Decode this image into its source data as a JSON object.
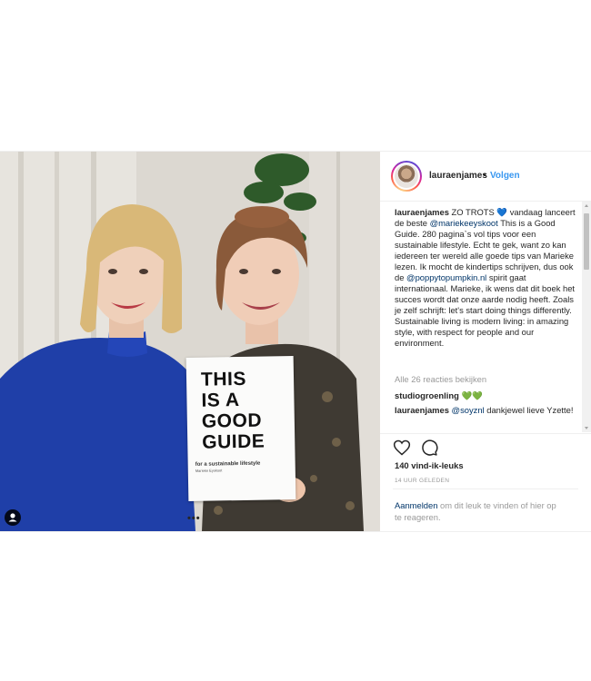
{
  "post": {
    "username": "lauraenjames",
    "dot": "•",
    "follow_label": "Volgen",
    "caption": {
      "username": "lauraenjames",
      "part1": "ZO TROTS",
      "heart": "💙",
      "part2": "vandaag lanceert de beste",
      "mention1": "@mariekeeyskoot",
      "part3": "This is a Good Guide. 280 pagina`s vol tips voor een sustainable lifestyle. Echt te gek, want zo kan iedereen ter wereld alle goede tips van Marieke lezen. Ik mocht de kindertips schrijven, dus ook de",
      "mention2": "@poppytopumpkin.nl",
      "part4": "spirit gaat internationaal. Marieke, ik wens dat dit boek het succes wordt dat onze aarde nodig heeft. Zoals je zelf schrijft: let's start doing things differently. Sustainable living is modern living: in amazing style, with respect for people and our environment."
    },
    "view_all_comments": "Alle 26 reacties bekijken",
    "comments": [
      {
        "username": "studiogroenling",
        "text": "",
        "hearts": "💚💚"
      },
      {
        "username": "lauraenjames",
        "mention": "@soyznl",
        "text": "dankjewel lieve Yzette!"
      }
    ],
    "likes": "140 vind-ik-leuks",
    "time": "14 UUR GELEDEN",
    "login": {
      "link": "Aanmelden",
      "text": "om dit leuk te vinden of hier op te reageren."
    },
    "more": "•••"
  },
  "book": {
    "line1": "THIS",
    "line2": "IS A",
    "line3": "GOOD",
    "line4": "GUIDE",
    "subtitle": "for a sustainable lifestyle",
    "author": "Marieke Eyskoot"
  },
  "colors": {
    "accent": "#3897f0",
    "mention": "#003569",
    "muted": "#999999"
  },
  "icons": [
    "user-tag-icon",
    "heart-icon",
    "comment-icon",
    "more-icon"
  ]
}
